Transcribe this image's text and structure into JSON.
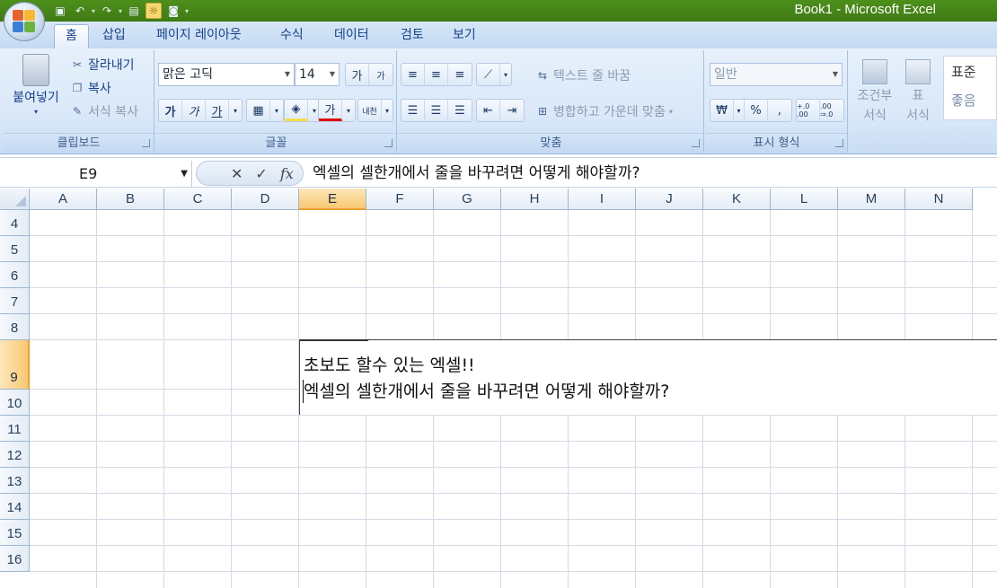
{
  "app": {
    "title": "Book1 - Microsoft Excel",
    "accent": "#3f7a14"
  },
  "quick_access": {
    "icons": [
      "save-icon",
      "undo-icon",
      "redo-icon",
      "print-preview-icon",
      "sun-icon",
      "camera-icon"
    ]
  },
  "tabs": [
    {
      "label": "홈",
      "selected": true
    },
    {
      "label": "삽입"
    },
    {
      "label": "페이지 레이아웃"
    },
    {
      "label": "수식"
    },
    {
      "label": "데이터"
    },
    {
      "label": "검토"
    },
    {
      "label": "보기"
    }
  ],
  "ribbon": {
    "clipboard": {
      "label": "클립보드",
      "paste": "붙여넣기",
      "cut": "잘라내기",
      "copy": "복사",
      "format_painter": "서식 복사"
    },
    "font": {
      "label": "글꼴",
      "font_name": "맑은 고딕",
      "font_size": "14",
      "grow": "가",
      "shrink": "가",
      "bold": "가",
      "italic": "가",
      "underline": "가",
      "font_color": "가",
      "phonetic": "내천"
    },
    "alignment": {
      "label": "맞춤",
      "wrap_text": "텍스트 줄 바꿈",
      "merge_center": "병합하고 가운데 맞춤"
    },
    "number": {
      "label": "표시 형식",
      "format": "일반",
      "currency": "₩",
      "percent": "%",
      "comma": ",",
      "inc_decimal": "+.0 .00",
      "dec_decimal": ".00 ⇒.0"
    },
    "styles": {
      "conditional": "조건부",
      "conditional_sub": "서식",
      "table": "표",
      "table_sub": "서식",
      "normal": "표준",
      "good": "좋음"
    }
  },
  "formula_bar": {
    "name_box": "E9",
    "formula": "엑셀의 셀한개에서 줄을 바꾸려면 어떻게 해야할까?"
  },
  "sheet": {
    "columns": [
      "A",
      "B",
      "C",
      "D",
      "E",
      "F",
      "G",
      "H",
      "I",
      "J",
      "K",
      "L",
      "M",
      "N"
    ],
    "active_column": "E",
    "rows": [
      "4",
      "5",
      "6",
      "7",
      "8",
      "9",
      "10",
      "11",
      "12",
      "13",
      "14",
      "15",
      "16"
    ],
    "active_row": "9",
    "cell_e9": {
      "line1": "초보도 할수 있는 엑셀!!",
      "line2": "엑셀의 셀한개에서 줄을 바꾸려면 어떻게 해야할까?"
    }
  }
}
